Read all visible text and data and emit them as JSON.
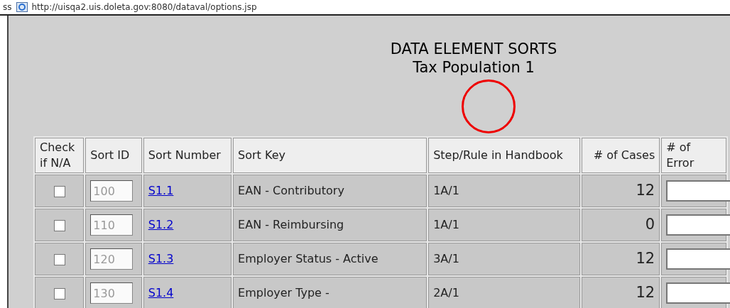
{
  "address_bar": {
    "label": "ss",
    "url": "http://uisqa2.uis.doleta.gov:8080/dataval/options.jsp"
  },
  "title": "DATA ELEMENT SORTS",
  "subtitle": "Tax Population 1",
  "table": {
    "columns": [
      "Check if N/A",
      "Sort ID",
      "Sort Number",
      "Sort Key",
      "Step/Rule in Handbook",
      "# of Cases",
      "# of Error"
    ],
    "rows": [
      {
        "checked": false,
        "sort_id": "100",
        "sort_number": "S1.1",
        "sort_key": "EAN - Contributory",
        "step_rule": "1A/1",
        "cases": "12"
      },
      {
        "checked": false,
        "sort_id": "110",
        "sort_number": "S1.2",
        "sort_key": "EAN - Reimbursing",
        "step_rule": "1A/1",
        "cases": "0"
      },
      {
        "checked": false,
        "sort_id": "120",
        "sort_number": "S1.3",
        "sort_key": "Employer Status - Active",
        "step_rule": "3A/1",
        "cases": "12"
      },
      {
        "checked": false,
        "sort_id": "130",
        "sort_number": "S1.4",
        "sort_key": "Employer Type -",
        "step_rule": "2A/1",
        "cases": "12"
      }
    ]
  }
}
